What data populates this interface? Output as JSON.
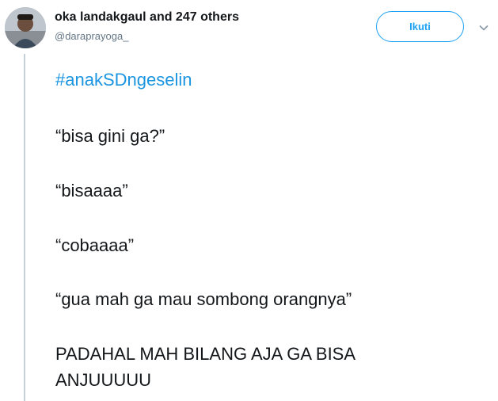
{
  "tweet": {
    "display_name": "oka landakgaul and 247 others",
    "handle": "@daraprayoga_",
    "follow_label": "Ikuti",
    "hashtag": "#anakSDngeselin",
    "lines": [
      "“bisa gini ga?”",
      "“bisaaaa”",
      "“cobaaaa”",
      "“gua mah ga mau sombong orangnya”",
      "PADAHAL MAH BILANG AJA GA BISA",
      "ANJUUUUU"
    ]
  },
  "colors": {
    "accent": "#1da1f2",
    "hashtag": "#1b95e0",
    "text": "#14171a",
    "secondary": "#657786",
    "thread_line": "#c4cfd6"
  },
  "icons": {
    "avatar": "avatar",
    "caret": "chevron-down-icon"
  }
}
